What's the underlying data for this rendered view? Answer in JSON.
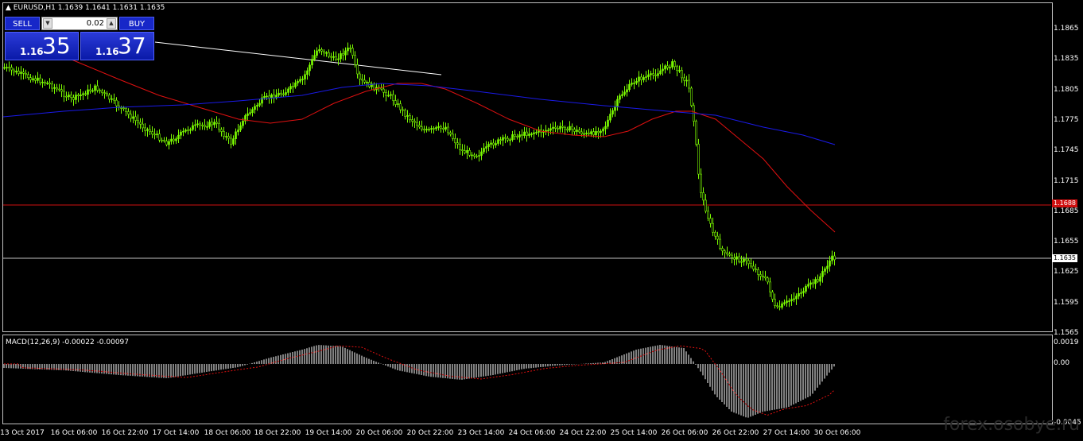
{
  "header": {
    "symbol_timeframe": "EURUSD,H1",
    "ohlc": "1.1639 1.1641 1.1631 1.1635",
    "macd_label": "MACD(12,26,9) -0.00022 -0.00097"
  },
  "trade_panel": {
    "sell_label": "SELL",
    "buy_label": "BUY",
    "lot_value": "0.02",
    "sell_prefix": "1.16",
    "sell_big": "35",
    "buy_prefix": "1.16",
    "buy_big": "37"
  },
  "price_axis": [
    "1.1865",
    "1.1835",
    "1.1805",
    "1.1775",
    "1.1745",
    "1.1715",
    "1.1685",
    "1.1655",
    "1.1625",
    "1.1595",
    "1.1565"
  ],
  "macd_axis": [
    "0.0019",
    "0.00",
    "-0.0045"
  ],
  "price_tags": {
    "red_line": "1.1688",
    "bid_line": "1.1635"
  },
  "time_axis": [
    "13 Oct 2017",
    "16 Oct 06:00",
    "16 Oct 22:00",
    "17 Oct 14:00",
    "18 Oct 06:00",
    "18 Oct 22:00",
    "19 Oct 14:00",
    "20 Oct 06:00",
    "20 Oct 22:00",
    "23 Oct 14:00",
    "24 Oct 06:00",
    "24 Oct 22:00",
    "25 Oct 14:00",
    "26 Oct 06:00",
    "26 Oct 22:00",
    "27 Oct 14:00",
    "30 Oct 06:00"
  ],
  "watermark": "forex.osobye.ru",
  "colors": {
    "candle": "#7cfc00",
    "ma_fast": "#e01010",
    "ma_slow": "#1a1ae8",
    "trend_line": "#ffffff",
    "level_line": "#d01010",
    "bid_line": "#c0c0c0",
    "macd_hist": "#ffffff",
    "macd_signal": "#e01010",
    "panel_blue": "#1727c8"
  },
  "chart_data": [
    {
      "type": "line",
      "title": "EURUSD,H1",
      "ylim": [
        1.1565,
        1.1885
      ],
      "x": [
        "13 Oct 2017",
        "16 Oct 06:00",
        "16 Oct 22:00",
        "17 Oct 14:00",
        "18 Oct 06:00",
        "18 Oct 22:00",
        "19 Oct 14:00",
        "20 Oct 06:00",
        "20 Oct 22:00",
        "23 Oct 14:00",
        "24 Oct 06:00",
        "24 Oct 22:00",
        "25 Oct 14:00",
        "26 Oct 06:00",
        "26 Oct 22:00",
        "27 Oct 14:00",
        "30 Oct 06:00"
      ],
      "series": [
        {
          "values": [
            1.1825,
            1.18,
            1.179,
            1.176,
            1.177,
            1.18,
            1.185,
            1.18,
            1.177,
            1.1755,
            1.177,
            1.1765,
            1.182,
            1.18,
            1.164,
            1.159,
            1.1635
          ]
        }
      ],
      "levels": [
        1.1688,
        1.1635
      ]
    },
    {
      "type": "bar",
      "title": "MACD(12,26,9) -0.00022 -0.00097",
      "ylim": [
        -0.0045,
        0.0019
      ],
      "series": [
        {
          "values": [
            0.0,
            -0.0005,
            -0.0007,
            -0.001,
            -0.0006,
            0.0003,
            0.0014,
            0.0002,
            -0.001,
            -0.0012,
            -0.0005,
            0.0001,
            0.0006,
            0.001,
            -0.004,
            -0.0035,
            -0.0002
          ]
        }
      ]
    }
  ]
}
